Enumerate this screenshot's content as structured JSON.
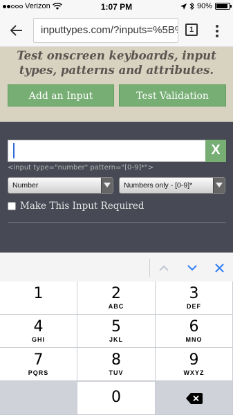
{
  "status_bar": {
    "carrier": "Verizon",
    "time": "1:07 PM",
    "battery": "90%",
    "battery_level": 0.9,
    "icons": [
      "signal-dots-icon",
      "wifi-icon",
      "location-arrow-icon",
      "bluetooth-icon",
      "battery-icon"
    ]
  },
  "browser": {
    "url": "inputtypes.com/?inputs=%5B%",
    "tab_count": "1"
  },
  "hero": {
    "title": "Test onscreen keyboards, input types, patterns and attributes.",
    "add_button": "Add an Input",
    "validate_button": "Test Validation"
  },
  "form": {
    "input_value": "",
    "clear_button": "X",
    "code_hint": "<input type=\"number\" pattern=\"[0-9]*\">",
    "type_select": "Number",
    "pattern_select": "Numbers only - [0-9]*",
    "required_label": "Make This Input Required"
  },
  "keyboard": {
    "rows": [
      [
        {
          "num": "1",
          "letters": ""
        },
        {
          "num": "2",
          "letters": "ABC"
        },
        {
          "num": "3",
          "letters": "DEF"
        }
      ],
      [
        {
          "num": "4",
          "letters": "GHI"
        },
        {
          "num": "5",
          "letters": "JKL"
        },
        {
          "num": "6",
          "letters": "MNO"
        }
      ],
      [
        {
          "num": "7",
          "letters": "PQRS"
        },
        {
          "num": "8",
          "letters": "TUV"
        },
        {
          "num": "9",
          "letters": "WXYZ"
        }
      ]
    ],
    "zero": "0"
  },
  "colors": {
    "accent_green": "#76ae74",
    "panel_bg": "#474a55",
    "hero_bg": "#d8d2c0",
    "ios_blue": "#2f7cf6"
  }
}
